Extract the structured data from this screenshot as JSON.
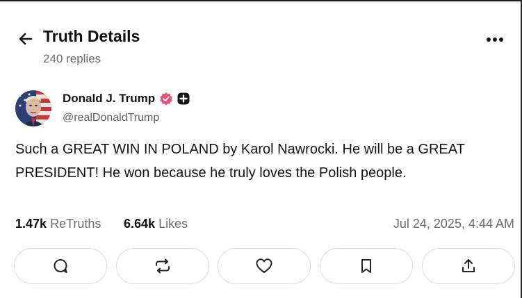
{
  "header": {
    "title": "Truth Details",
    "replies": "240 replies",
    "back_icon": "arrow-left-icon",
    "more_icon": "ellipsis-horizontal-icon"
  },
  "post": {
    "author": {
      "display_name": "Donald J. Trump",
      "handle": "@realDonaldTrump",
      "verified_color": "#e8507a"
    },
    "text": "Such a GREAT WIN IN POLAND by Karol Nawrocki. He will be a GREAT PRESIDENT! He won because he truly loves the Polish people.",
    "stats": {
      "retruths_count": "1.47k",
      "retruths_label": "ReTruths",
      "likes_count": "6.64k",
      "likes_label": "Likes"
    },
    "timestamp": "Jul 24, 2025, 4:44 AM"
  },
  "actions": [
    {
      "icon": "reply-icon"
    },
    {
      "icon": "retruth-icon"
    },
    {
      "icon": "heart-icon"
    },
    {
      "icon": "bookmark-icon"
    },
    {
      "icon": "share-icon"
    }
  ]
}
